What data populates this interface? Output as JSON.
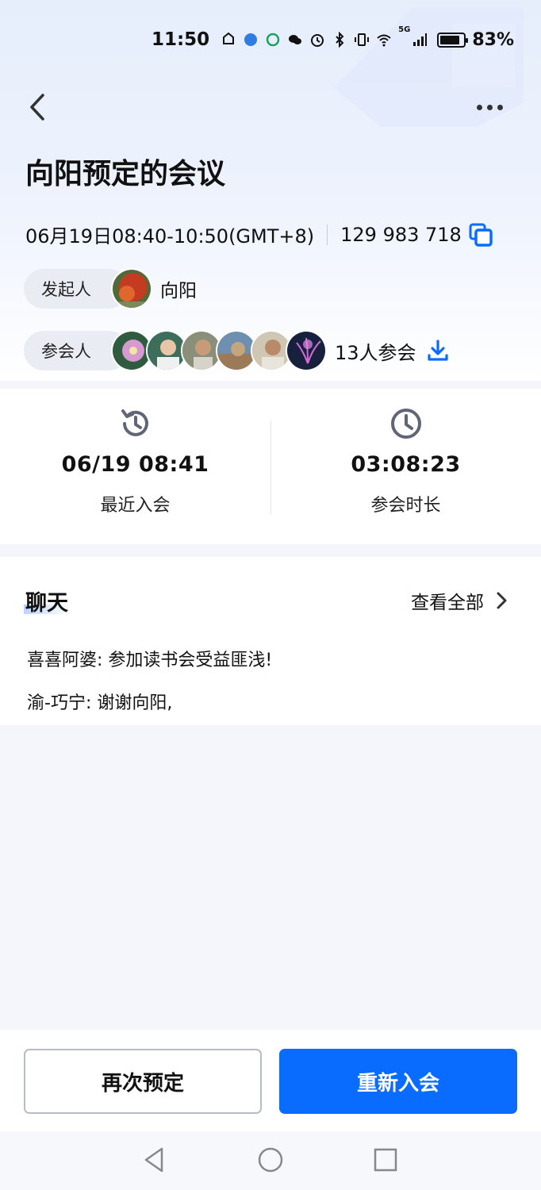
{
  "status_bar": {
    "time": "11:50",
    "signal_label": "5G",
    "battery": "83%",
    "battery_level": 0.83
  },
  "header": {
    "title": "向阳预定的会议"
  },
  "meeting": {
    "datetime": "06月19日08:40-10:50(GMT+8)",
    "meeting_id": "129 983 718"
  },
  "organizer": {
    "label": "发起人",
    "name": "向阳"
  },
  "participants": {
    "label": "参会人",
    "count_text": "13人参会"
  },
  "stats": {
    "recent_join": {
      "value": "06/19 08:41",
      "label": "最近入会"
    },
    "duration": {
      "value": "03:08:23",
      "label": "参会时长"
    }
  },
  "chat": {
    "title": "聊天",
    "view_all": "查看全部",
    "messages": [
      {
        "text": "喜喜阿婆: 参加读书会受益匪浅!"
      },
      {
        "text": "渝-巧宁: 谢谢向阳,"
      }
    ]
  },
  "actions": {
    "rebook": "再次预定",
    "rejoin": "重新入会"
  },
  "colors": {
    "accent": "#0a6cff",
    "icon_gray": "#5f6675"
  },
  "icons": {
    "back": "chevron-left-icon",
    "more": "more-icon",
    "copy": "copy-icon",
    "download": "download-icon",
    "history": "history-icon",
    "clock": "clock-icon",
    "chevron": "chevron-right-icon"
  }
}
